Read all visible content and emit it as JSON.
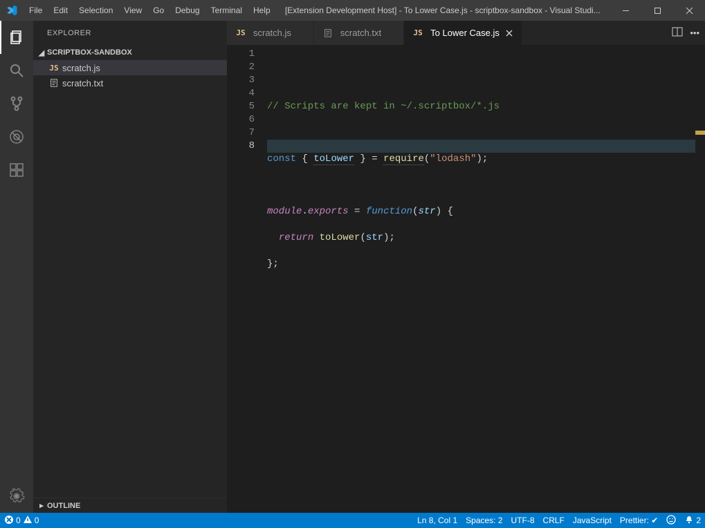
{
  "menu": {
    "items": [
      "File",
      "Edit",
      "Selection",
      "View",
      "Go",
      "Debug",
      "Terminal",
      "Help"
    ]
  },
  "title": "[Extension Development Host] - To Lower Case.js - scriptbox-sandbox - Visual Studi...",
  "sidebar": {
    "title": "EXPLORER",
    "section": "SCRIPTBOX-SANDBOX",
    "files": [
      {
        "name": "scratch.js",
        "icon": "js"
      },
      {
        "name": "scratch.txt",
        "icon": "txt"
      }
    ],
    "outline": "OUTLINE"
  },
  "tabs": [
    {
      "label": "scratch.js",
      "icon": "js",
      "active": false
    },
    {
      "label": "scratch.txt",
      "icon": "txt",
      "active": false
    },
    {
      "label": "To Lower Case.js",
      "icon": "js",
      "active": true
    }
  ],
  "code": {
    "line1": "// Scripts are kept in ~/.scriptbox/*.js",
    "line3_const": "const",
    "line3_toLower": "toLower",
    "line3_require": "require",
    "line3_lodash": "\"lodash\"",
    "line5_module": "module",
    "line5_dot": ".",
    "line5_exports": "exports",
    "line5_eq": " = ",
    "line5_function": "function",
    "line5_str": "str",
    "line6_return": "return",
    "line6_toLower": "toLower",
    "line6_str": "str",
    "line7": "};"
  },
  "gutter": [
    "1",
    "2",
    "3",
    "4",
    "5",
    "6",
    "7",
    "8"
  ],
  "status": {
    "errors": "0",
    "warnings": "0",
    "cursor": "Ln 8, Col 1",
    "spaces": "Spaces: 2",
    "encoding": "UTF-8",
    "eol": "CRLF",
    "lang": "JavaScript",
    "prettier": "Prettier: ✔",
    "bell": "2"
  }
}
